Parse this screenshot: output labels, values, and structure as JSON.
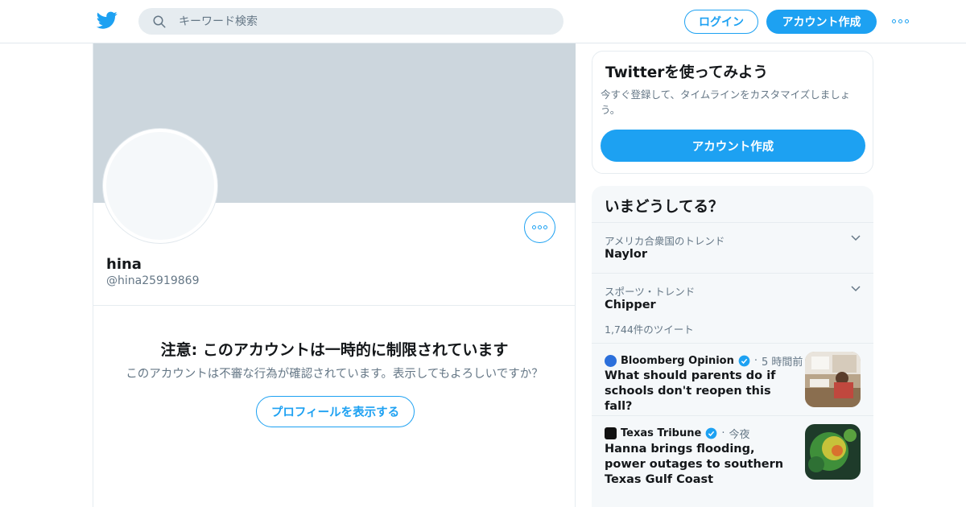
{
  "header": {
    "search_placeholder": "キーワード検索",
    "login_label": "ログイン",
    "signup_label": "アカウント作成"
  },
  "profile": {
    "name": "hina",
    "handle": "@hina25919869",
    "warning_title": "注意: このアカウントは一時的に制限されています",
    "warning_text": "このアカウントは不審な行為が確認されています。表示してもよろしいですか？",
    "view_button_label": "プロフィールを表示する"
  },
  "signup_card": {
    "title": "Twitterを使ってみよう",
    "description": "今すぐ登録して、タイムラインをカスタマイズしましょう。",
    "button_label": "アカウント作成"
  },
  "trends": {
    "title": "いまどうしてる？",
    "items": [
      {
        "category": "アメリカ合衆国のトレンド",
        "name": "Naylor",
        "count": ""
      },
      {
        "category": "スポーツ・トレンド",
        "name": "Chipper",
        "count": "1,744件のツイート"
      }
    ],
    "news": [
      {
        "source": "Bloomberg Opinion",
        "time": "5 時間前",
        "headline": "What should parents do if schools don't reopen this fall?",
        "verified": true
      },
      {
        "source": "Texas Tribune",
        "time": "今夜",
        "headline": "Hanna brings flooding, power outages to southern Texas Gulf Coast",
        "verified": true
      }
    ]
  },
  "colors": {
    "accent": "#1da1f2",
    "secondary_text": "#657786",
    "banner": "#ccd6dd",
    "panel_bg": "#f5f8fa"
  },
  "icons": [
    "twitter-bird-icon",
    "search-icon",
    "more-dots-icon",
    "chevron-down-icon",
    "verified-badge-icon"
  ]
}
